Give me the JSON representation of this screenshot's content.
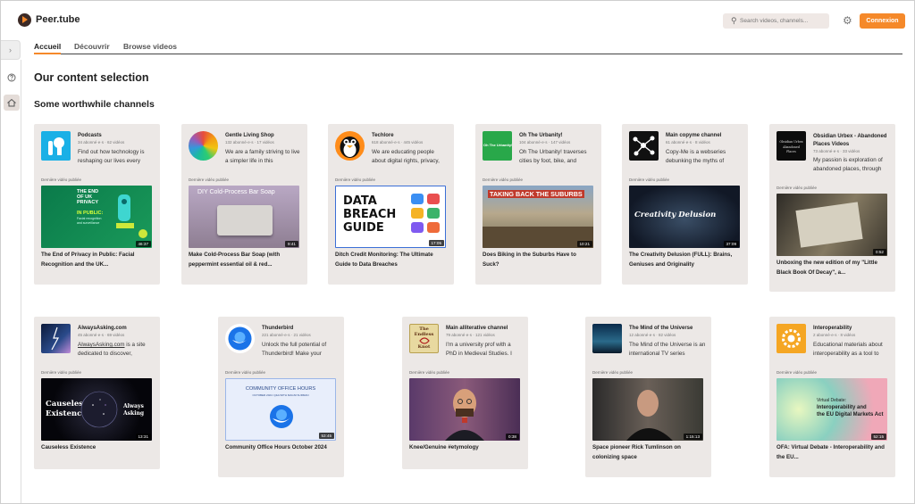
{
  "header": {
    "app_title": "Peer.tube",
    "search_placeholder": "Search videos, channels...",
    "login_label": "Connexion"
  },
  "tabs": [
    {
      "label": "Accueil"
    },
    {
      "label": "Découvrir"
    },
    {
      "label": "Browse videos"
    }
  ],
  "main": {
    "title": "Our content selection",
    "section_title": "Some worthwhile channels"
  },
  "last_label": "Dernière vidéo publiée",
  "channels": [
    {
      "name": "Podcasts",
      "stats": "34 abonné·e·s · 62 vidéos",
      "desc": "Find out how technology is reshaping our lives every",
      "video_title": "The End of Privacy in Public: Facial Recognition and the UK...",
      "duration": "46:37"
    },
    {
      "name": "Gentle Living Shop",
      "stats": "132 abonné·e·s · 17 vidéos",
      "desc": "We are a family striving to live a simpler life in this",
      "video_title": "Make Cold-Process Bar Soap (with peppermint essential oil & red...",
      "duration": "9:41"
    },
    {
      "name": "Techlore",
      "stats": "618 abonné·e·s · 445 vidéos",
      "desc": "We are educating people about digital rights, privacy,",
      "video_title": "Ditch Credit Monitoring: The Ultimate Guide to Data Breaches",
      "duration": "17:05"
    },
    {
      "name": "Oh The Urbanity!",
      "stats": "104 abonné·e·s · 147 vidéos",
      "desc": "Oh The Urbanity! traverses cities by foot, bike, and",
      "video_title": "Does Biking in the Suburbs Have to Suck?",
      "duration": "10:21"
    },
    {
      "name": "Main copyme channel",
      "stats": "61 abonné·e·s · 8 vidéos",
      "desc": "Copy-Me is a webseries debunking the myths of",
      "video_title": "The Creativity Delusion (FULL): Brains, Geniuses and Originality",
      "duration": "37:09"
    },
    {
      "name": "Obsidian Urbex - Abandoned Places Videos",
      "stats": "73 abonné·e·s · 33 vidéos",
      "desc": "My passion is exploration of abandoned places, through",
      "video_title": "Unboxing the new edition of my \"Little Black Book Of Decay\", a...",
      "duration": "0:52"
    },
    {
      "name": "AlwaysAsking.com",
      "stats": "45 abonné·e·s · 69 vidéos",
      "desc_link": "AlwaysAsking.com",
      "desc": " is a site dedicated to discover,",
      "video_title": "Causeless Existence",
      "duration": "13:31"
    },
    {
      "name": "Thunderbird",
      "stats": "221 abonné·e·s · 21 vidéos",
      "desc": "Unlock the full potential of Thunderbird! Make your",
      "video_title": "Community Office Hours October 2024",
      "duration": "53:45"
    },
    {
      "name": "Main alliterative channel",
      "stats": "79 abonné·e·s · 121 vidéos",
      "desc": "I'm a university prof with a PhD in Medieval Studies. I",
      "video_title": "Knee/Genuine #etymology",
      "duration": "0:38"
    },
    {
      "name": "The Mind of the Universe",
      "stats": "12 abonné·e·s · 82 vidéos",
      "desc": "The Mind of the Universe is an international TV series",
      "video_title": "Space pioneer Rick Tumlinson on colonizing space",
      "duration": "1:15:13"
    },
    {
      "name": "Interoperability",
      "stats": "2 abonné·e·s · 8 vidéos",
      "desc": "Educational materials about interoperability as a tool to",
      "video_title": "OFA: Virtual Debate - Interoperability and the EU...",
      "duration": "52:15"
    }
  ],
  "thumb_text": {
    "podcasts": [
      "THE END",
      "OF UK",
      "PRIVACY",
      "IN PUBLIC:",
      "Facial recognition",
      "and surveillance"
    ],
    "soap": "DIY Cold-Process Bar Soap",
    "techlore": [
      "DATA",
      "BREACH",
      "GUIDE"
    ],
    "urbanity": [
      "TAKING BACK THE SUBURBS"
    ],
    "copyme": "Creativity Delusion",
    "causeless": [
      "Causeless",
      "Existence",
      "Always",
      "Asking"
    ],
    "thunderbird": [
      "COMMUNITY OFFICE HOURS",
      "OCTOBER 2024: Q&A WITH MAGNI SURMAN"
    ],
    "interop": [
      "Virtual Debate:",
      "Interoperability and",
      "the EU Digital Markets Act"
    ],
    "avatar_labels": {
      "urbanity": "Oh The Urbanity!",
      "knot": [
        "The",
        "Endless",
        "Knot"
      ],
      "obsidian": [
        "Obsidian Urbex",
        "Abandoned",
        "Places"
      ]
    }
  }
}
